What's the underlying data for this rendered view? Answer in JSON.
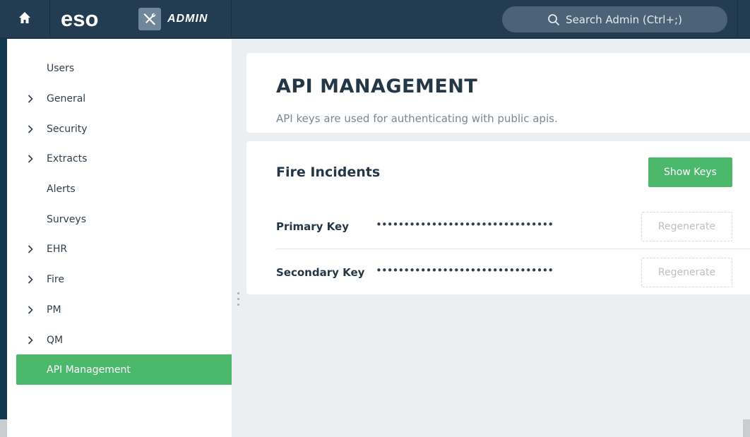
{
  "topbar": {
    "home_icon": "home-icon",
    "logo": "eso",
    "admin_icon": "wrench-screwdriver-icon",
    "admin_label": "ADMIN",
    "search_placeholder": "Search Admin (Ctrl+;)"
  },
  "sidebar": {
    "items": [
      {
        "label": "Users",
        "expandable": false
      },
      {
        "label": "General",
        "expandable": true
      },
      {
        "label": "Security",
        "expandable": true
      },
      {
        "label": "Extracts",
        "expandable": true
      },
      {
        "label": "Alerts",
        "expandable": false
      },
      {
        "label": "Surveys",
        "expandable": false
      },
      {
        "label": "EHR",
        "expandable": true
      },
      {
        "label": "Fire",
        "expandable": true
      },
      {
        "label": "PM",
        "expandable": true
      },
      {
        "label": "QM",
        "expandable": true
      },
      {
        "label": "API Management",
        "expandable": false,
        "active": true
      }
    ]
  },
  "main": {
    "title": "API MANAGEMENT",
    "subtitle": "API keys are used for authenticating with public apis.",
    "card": {
      "title": "Fire Incidents",
      "show_keys_label": "Show Keys",
      "rows": [
        {
          "label": "Primary Key",
          "value": "••••••••••••••••••••••••••••••••",
          "button": "Regenerate"
        },
        {
          "label": "Secondary Key",
          "value": "••••••••••••••••••••••••••••••••",
          "button": "Regenerate"
        }
      ]
    }
  },
  "colors": {
    "accent_green": "#4cb86c",
    "topbar_bg": "#233c52",
    "frame_bg": "#12374f"
  }
}
